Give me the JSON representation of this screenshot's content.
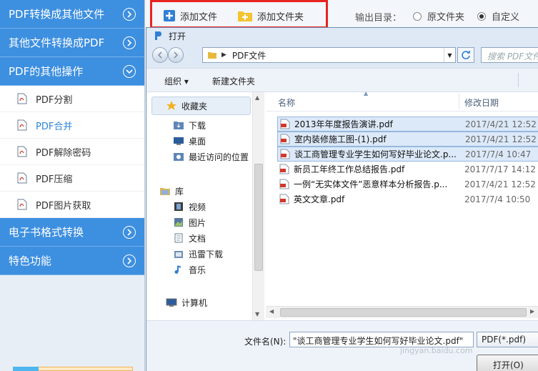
{
  "sidebar": {
    "categories": [
      {
        "label": "PDF转换成其他文件"
      },
      {
        "label": "其他文件转换成PDF"
      },
      {
        "label": "PDF的其他操作"
      },
      {
        "label": "电子书格式转换"
      },
      {
        "label": "特色功能"
      }
    ],
    "sub_items": [
      {
        "label": "PDF分割"
      },
      {
        "label": "PDF合并"
      },
      {
        "label": "PDF解除密码"
      },
      {
        "label": "PDF压缩"
      },
      {
        "label": "PDF图片获取"
      }
    ],
    "active_sub_item": "PDF合并",
    "accent_color": "#3d8fe0"
  },
  "toolbar": {
    "add_file_label": "添加文件",
    "add_folder_label": "添加文件夹",
    "output_label": "输出目录：",
    "option_original": "原文件夹",
    "option_custom": "自定义",
    "selected_option": "自定义",
    "highlight_color": "#e8231f"
  },
  "dialog": {
    "title": "打开",
    "address": "PDF文件",
    "search_placeholder": "搜索 PDF文件",
    "organize_label": "组织 ▾",
    "new_folder_label": "新建文件夹",
    "nav": {
      "favorites": "收藏夹",
      "downloads": "下载",
      "desktop": "桌面",
      "recent": "最近访问的位置",
      "libraries": "库",
      "videos": "视频",
      "pictures": "图片",
      "documents": "文档",
      "thunder": "迅雷下载",
      "music": "音乐",
      "computer": "计算机"
    },
    "columns": {
      "name": "名称",
      "date": "修改日期"
    },
    "files": [
      {
        "name": "2013年年度报告演讲.pdf",
        "date": "2017/4/21 12:52",
        "selected": true
      },
      {
        "name": "室内装修施工图-(1).pdf",
        "date": "2017/4/21 12:52",
        "selected": true
      },
      {
        "name": "谈工商管理专业学生如何写好毕业论文.p...",
        "date": "2017/7/4 10:47",
        "selected": true
      },
      {
        "name": "新员工年终工作总结报告.pdf",
        "date": "2017/7/17 14:12",
        "selected": false
      },
      {
        "name": "一例“无实体文件”恶意样本分析报告.p...",
        "date": "2017/4/21 12:52",
        "selected": false
      },
      {
        "name": "英文文章.pdf",
        "date": "2017/7/4 10:50",
        "selected": false
      }
    ],
    "filename_label": "文件名(N):",
    "filename_value": "\"谈工商管理专业学生如何写好毕业论文.pdf\"",
    "filetype_value": "PDF(*.pdf)",
    "open_label": "打开(O)"
  },
  "watermark": "jingyan.baidu.com"
}
